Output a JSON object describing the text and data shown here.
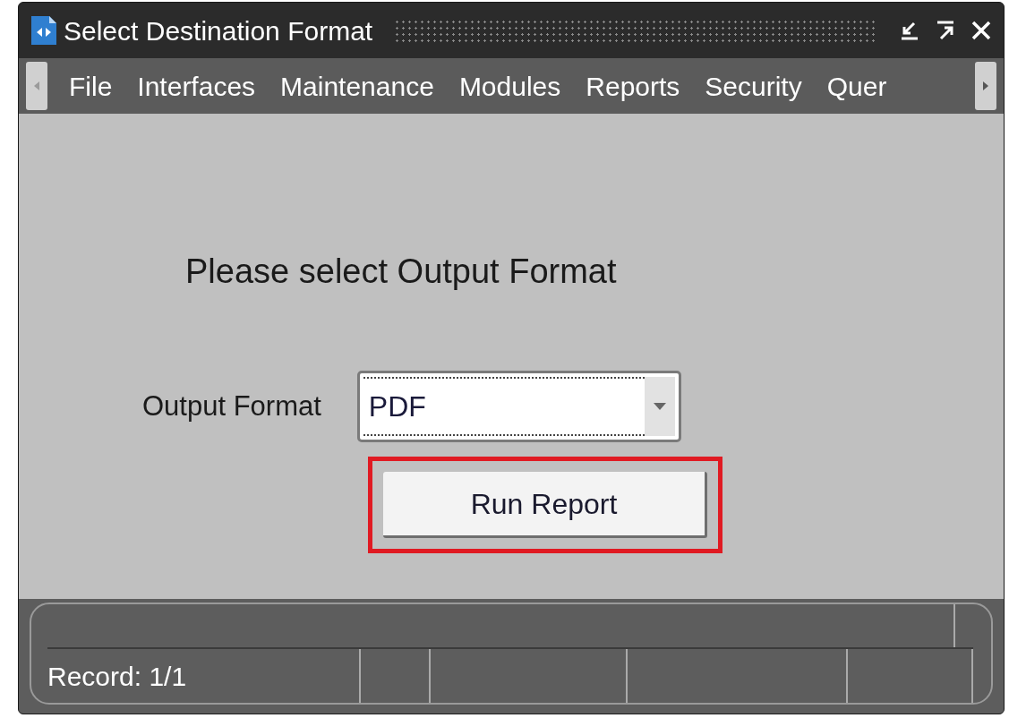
{
  "window": {
    "title": "Select Destination Format"
  },
  "menu": {
    "items": [
      {
        "label": "File"
      },
      {
        "label": "Interfaces"
      },
      {
        "label": "Maintenance"
      },
      {
        "label": "Modules"
      },
      {
        "label": "Reports"
      },
      {
        "label": "Security"
      },
      {
        "label": "Quer"
      }
    ]
  },
  "form": {
    "heading": "Please select Output Format",
    "field_label": "Output Format",
    "value": "PDF",
    "button": "Run Report",
    "button_highlighted": true
  },
  "status_bar": {
    "record": "Record: 1/1"
  }
}
